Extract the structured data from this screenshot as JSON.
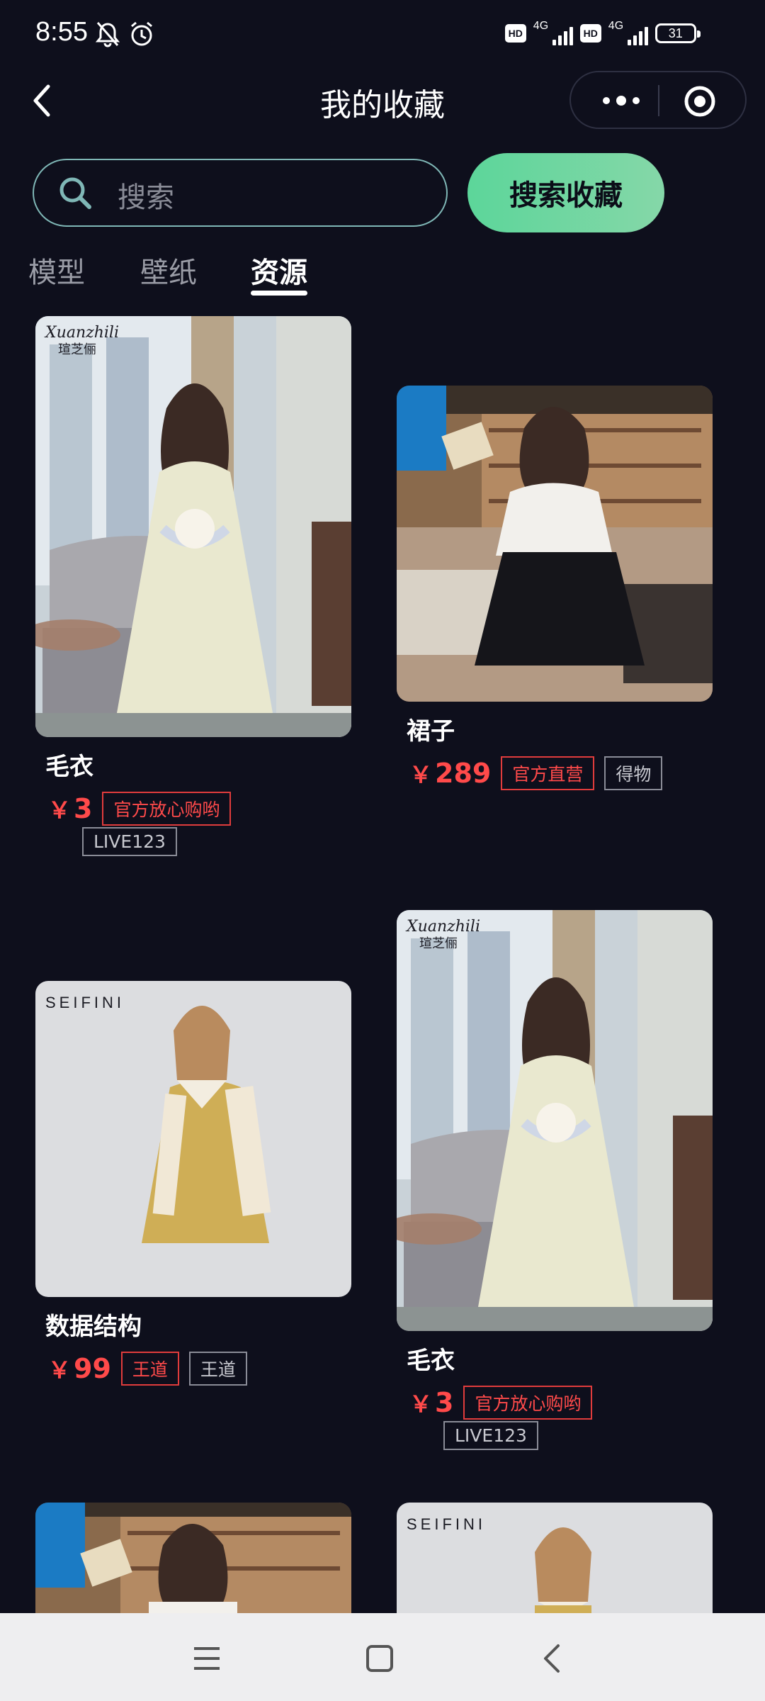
{
  "status_bar": {
    "time": "8:55",
    "network_label": "4G",
    "hd_label": "HD",
    "battery": "31"
  },
  "header": {
    "title": "我的收藏"
  },
  "search": {
    "placeholder": "搜索",
    "button_label": "搜索收藏"
  },
  "tabs": [
    {
      "label": "模型",
      "active": false
    },
    {
      "label": "壁纸",
      "active": false
    },
    {
      "label": "资源",
      "active": true
    }
  ],
  "products": [
    {
      "name": "毛衣",
      "price": "3",
      "currency": "￥",
      "tags_red": [
        "官方放心购哟"
      ],
      "tags_gray": [
        "LIVE123"
      ],
      "brand_text": "Xuanzhili",
      "brand_cn": "瑄芝俪"
    },
    {
      "name": "裙子",
      "price": "289",
      "currency": "￥",
      "tags_red": [
        "官方直营"
      ],
      "tags_gray": [
        "得物"
      ]
    },
    {
      "name": "数据结构",
      "price": "99",
      "currency": "￥",
      "tags_red": [
        "王道"
      ],
      "tags_gray": [
        "王道"
      ],
      "brand_text": "SEIFINI"
    },
    {
      "name": "毛衣",
      "price": "3",
      "currency": "￥",
      "tags_red": [
        "官方放心购哟"
      ],
      "tags_gray": [
        "LIVE123"
      ],
      "brand_text": "Xuanzhili",
      "brand_cn": "瑄芝俪"
    },
    {
      "name": "",
      "price": "",
      "currency": ""
    },
    {
      "name": "",
      "price": "",
      "currency": "",
      "brand_text": "SEIFINI"
    }
  ],
  "colors": {
    "background": "#0e0f1c",
    "accent_green": "#5cd69a",
    "price_red": "#ff4a4a",
    "search_border": "#7fb7b6"
  },
  "nav_bar": {
    "icons": [
      "menu-icon",
      "home-square-icon",
      "back-chevron-icon"
    ]
  }
}
